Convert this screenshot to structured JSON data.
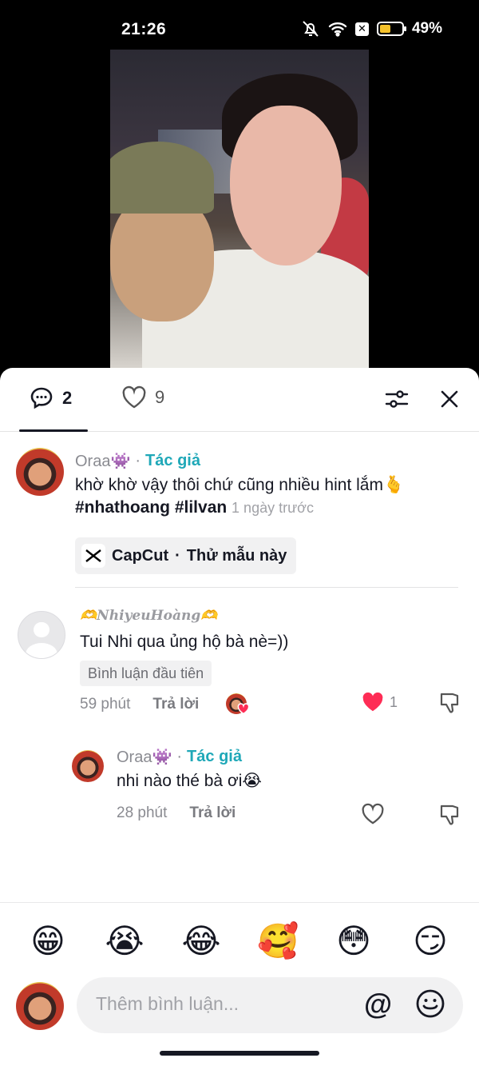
{
  "status_bar": {
    "time": "21:26",
    "battery_percent": "49%",
    "battery_level": 0.49,
    "battery_color": "#f5c22b"
  },
  "header": {
    "comment_count": "2",
    "like_count": "9"
  },
  "comments": [
    {
      "author": "Oraa👾",
      "author_tag": "Tác giả",
      "text": "khờ khờ vậy thôi chứ cũng nhiều hint lắm🫰",
      "hashtags": "#nhathoang #lilvan",
      "time": "1 ngày trước",
      "template": {
        "app": "CapCut",
        "sep": "·",
        "action": "Thử mẫu này"
      }
    },
    {
      "author": "🫶NhiyeuHoàng🫶",
      "text": "Tui Nhi qua ủng hộ bà nè=))",
      "badge": "Bình luận đầu tiên",
      "time": "59 phút",
      "reply_label": "Trả lời",
      "like_count": "1",
      "liked_by_author": true,
      "replies": [
        {
          "author": "Oraa👾",
          "author_tag": "Tác giả",
          "text": "nhi nào thé bà ơi😭",
          "time": "28 phút",
          "reply_label": "Trả lời"
        }
      ]
    }
  ],
  "emoji_bar": [
    "😁",
    "😭",
    "😂",
    "🥰",
    "😳",
    "😏"
  ],
  "input": {
    "placeholder": "Thêm bình luận...",
    "at_symbol": "@"
  },
  "colors": {
    "accent_author": "#1fa8b8",
    "like_red": "#fe2c55"
  }
}
